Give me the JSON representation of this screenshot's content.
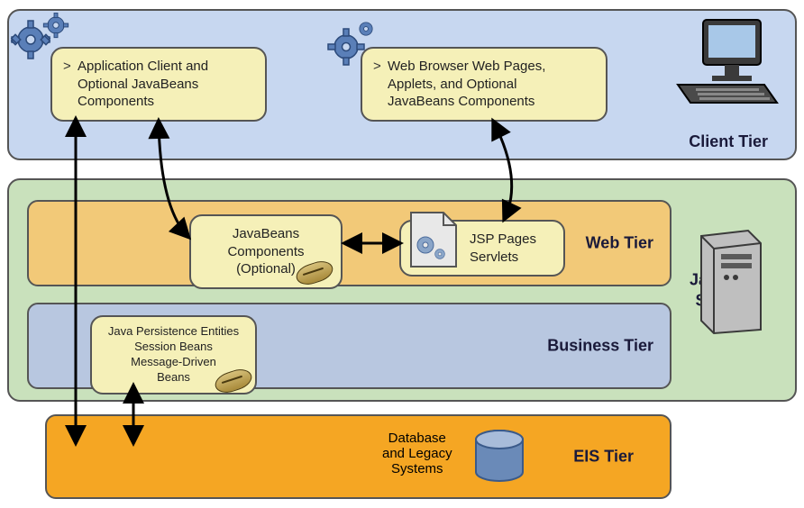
{
  "tiers": {
    "client": {
      "label": "Client Tier"
    },
    "server": {
      "label_line1": "Java EE",
      "label_line2": "Server"
    },
    "web": {
      "label": "Web Tier"
    },
    "business": {
      "label": "Business Tier"
    },
    "eis": {
      "label": "EIS Tier"
    }
  },
  "nodes": {
    "app_client": {
      "line1": "Application Client and",
      "line2": "Optional JavaBeans",
      "line3": "Components"
    },
    "web_browser": {
      "line1": "Web Browser Web Pages,",
      "line2": "Applets, and Optional",
      "line3": "JavaBeans Components"
    },
    "javabeans_opt": {
      "line1": "JavaBeans",
      "line2": "Components",
      "line3": "(Optional)"
    },
    "jsp": {
      "line1": "JSP Pages",
      "line2": "Servlets"
    },
    "ejb": {
      "line1": "Java Persistence Entities",
      "line2": "Session Beans",
      "line3": "Message-Driven",
      "line4": "Beans"
    },
    "db": {
      "line1": "Database",
      "line2": "and Legacy",
      "line3": "Systems"
    }
  },
  "icons": {
    "gear": "gear-icon",
    "bean": "bean-icon",
    "document": "document-icon",
    "computer": "computer-icon",
    "server": "server-icon",
    "cylinder": "database-cylinder-icon"
  },
  "colors": {
    "client_bg": "#c7d7f0",
    "server_bg": "#c9e1bc",
    "web_bg": "#f2c978",
    "business_bg": "#b8c7e0",
    "eis_bg": "#f5a623",
    "node_bg": "#f5f0b8",
    "gear_blue": "#5a7fb8"
  }
}
